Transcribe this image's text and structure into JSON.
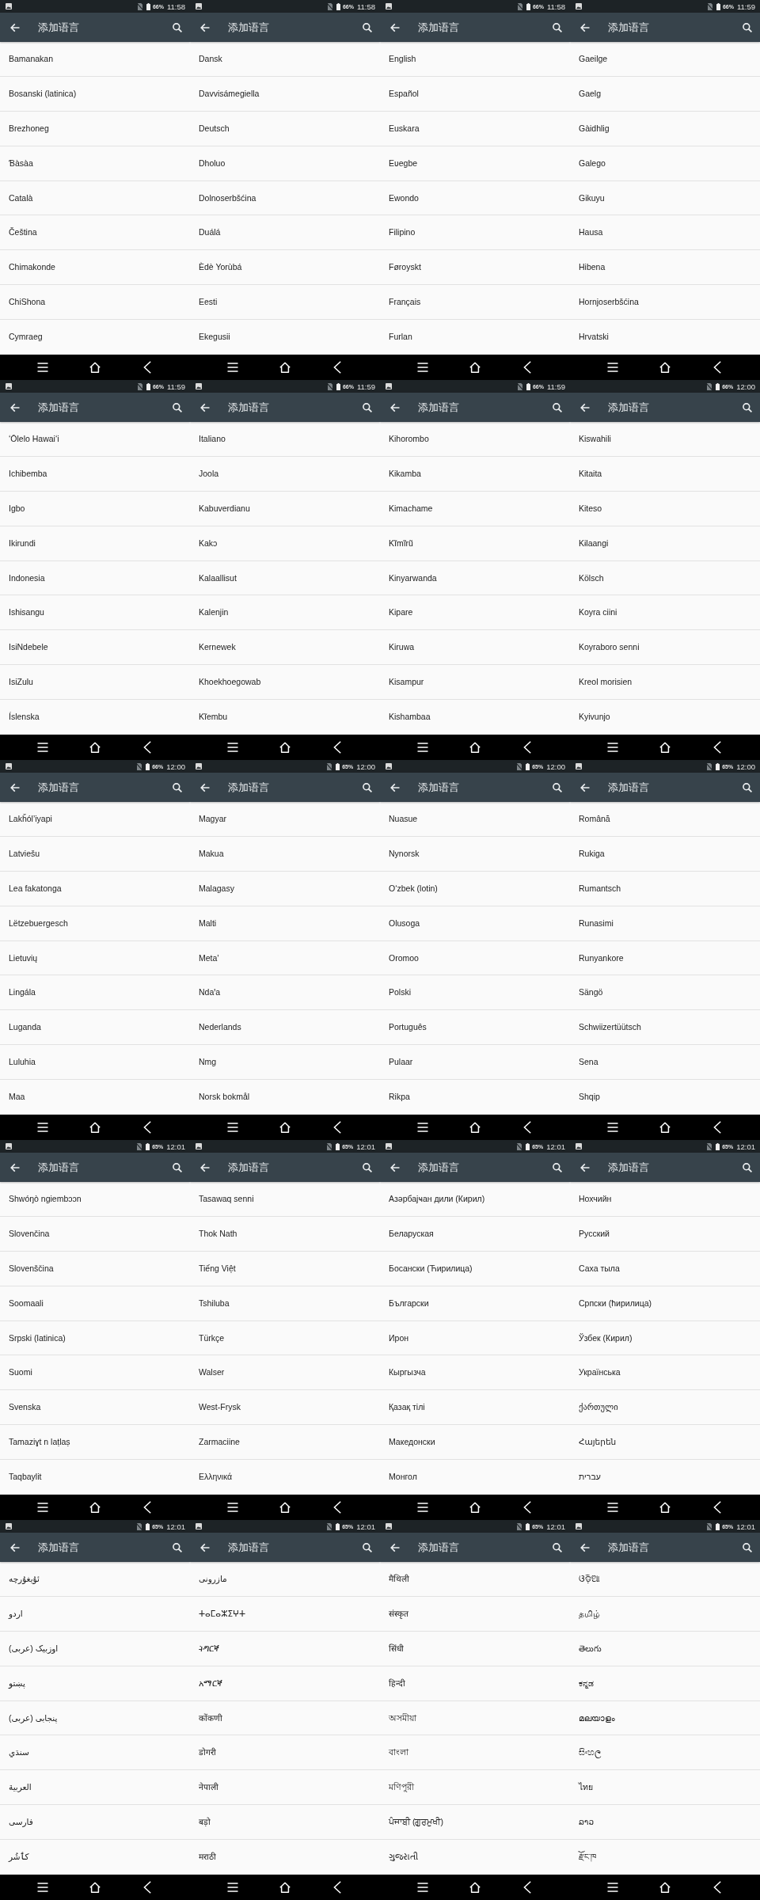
{
  "screens": [
    {
      "status_bar": {
        "picture_notification": true,
        "battery": "66%",
        "time": "11:58"
      },
      "app_bar": {
        "title": "添加语言"
      },
      "languages": [
        "Bamanakan",
        "Bosanski (latinica)",
        "Brezhoneg",
        "Ɓàsàa",
        "Català",
        "Čeština",
        "Chimakonde",
        "ChiShona",
        "Cymraeg"
      ]
    },
    {
      "status_bar": {
        "picture_notification": true,
        "battery": "66%",
        "time": "11:58"
      },
      "app_bar": {
        "title": "添加语言"
      },
      "languages": [
        "Dansk",
        "Davvisámegiella",
        "Deutsch",
        "Dholuo",
        "Dolnoserbšćina",
        "Duálá",
        "Èdè Yorùbá",
        "Eesti",
        "Ekegusii"
      ]
    },
    {
      "status_bar": {
        "picture_notification": true,
        "battery": "66%",
        "time": "11:58"
      },
      "app_bar": {
        "title": "添加语言"
      },
      "languages": [
        "English",
        "Español",
        "Euskara",
        "Eʋegbe",
        "Ewondo",
        "Filipino",
        "Føroyskt",
        "Français",
        "Furlan"
      ]
    },
    {
      "status_bar": {
        "picture_notification": true,
        "battery": "66%",
        "time": "11:59"
      },
      "app_bar": {
        "title": "添加语言"
      },
      "languages": [
        "Gaeilge",
        "Gaelg",
        "Gàidhlig",
        "Galego",
        "Gikuyu",
        "Hausa",
        "Hibena",
        "Hornjoserbšćina",
        "Hrvatski"
      ]
    },
    {
      "status_bar": {
        "picture_notification": true,
        "battery": "66%",
        "time": "11:59"
      },
      "app_bar": {
        "title": "添加语言"
      },
      "languages": [
        "ʻŌlelo Hawaiʻi",
        "Ichibemba",
        "Igbo",
        "Ikirundi",
        "Indonesia",
        "Ishisangu",
        "IsiNdebele",
        "IsiZulu",
        "Íslenska"
      ]
    },
    {
      "status_bar": {
        "picture_notification": true,
        "battery": "66%",
        "time": "11:59"
      },
      "app_bar": {
        "title": "添加语言"
      },
      "languages": [
        "Italiano",
        "Joola",
        "Kabuverdianu",
        "Kakɔ",
        "Kalaallisut",
        "Kalenjin",
        "Kernewek",
        "Khoekhoegowab",
        "Kĩembu"
      ]
    },
    {
      "status_bar": {
        "picture_notification": true,
        "battery": "66%",
        "time": "11:59"
      },
      "app_bar": {
        "title": "添加语言"
      },
      "languages": [
        "Kihorombo",
        "Kikamba",
        "Kimachame",
        "Kĩmĩrũ",
        "Kinyarwanda",
        "Kipare",
        "Kiruwa",
        "Kisampur",
        "Kishambaa"
      ]
    },
    {
      "status_bar": {
        "picture_notification": false,
        "battery": "66%",
        "time": "12:00"
      },
      "app_bar": {
        "title": "添加语言"
      },
      "languages": [
        "Kiswahili",
        "Kitaita",
        "Kiteso",
        "Kɨlaangi",
        "Kölsch",
        "Koyra ciini",
        "Koyraboro senni",
        "Kreol morisien",
        "Kyivunjo"
      ]
    },
    {
      "status_bar": {
        "picture_notification": true,
        "battery": "66%",
        "time": "12:00"
      },
      "app_bar": {
        "title": "添加语言"
      },
      "languages": [
        "Lakȟólʼiyapi",
        "Latviešu",
        "Lea fakatonga",
        "Lëtzebuergesch",
        "Lietuvių",
        "Lingála",
        "Luganda",
        "Luluhia",
        "Maa"
      ]
    },
    {
      "status_bar": {
        "picture_notification": true,
        "battery": "65%",
        "time": "12:00"
      },
      "app_bar": {
        "title": "添加语言"
      },
      "languages": [
        "Magyar",
        "Makua",
        "Malagasy",
        "Malti",
        "Metaʼ",
        "Ndaꞌa",
        "Nederlands",
        "Nmg",
        "Norsk bokmål"
      ]
    },
    {
      "status_bar": {
        "picture_notification": true,
        "battery": "65%",
        "time": "12:00"
      },
      "app_bar": {
        "title": "添加语言"
      },
      "languages": [
        "Nuasue",
        "Nynorsk",
        "O‘zbek (lotin)",
        "Olusoga",
        "Oromoo",
        "Polski",
        "Português",
        "Pulaar",
        "Rikpa"
      ]
    },
    {
      "status_bar": {
        "picture_notification": true,
        "battery": "65%",
        "time": "12:00"
      },
      "app_bar": {
        "title": "添加语言"
      },
      "languages": [
        "Română",
        "Rukiga",
        "Rumantsch",
        "Runasimi",
        "Runyankore",
        "Sängö",
        "Schwiizertüütsch",
        "Sena",
        "Shqip"
      ]
    },
    {
      "status_bar": {
        "picture_notification": true,
        "battery": "65%",
        "time": "12:01"
      },
      "app_bar": {
        "title": "添加语言"
      },
      "languages": [
        "Shwóŋò ngiembɔɔn",
        "Slovenčina",
        "Slovenščina",
        "Soomaali",
        "Srpski (latinica)",
        "Suomi",
        "Svenska",
        "Tamaziɣt n laṭlaṣ",
        "Taqbaylit"
      ]
    },
    {
      "status_bar": {
        "picture_notification": true,
        "battery": "65%",
        "time": "12:01"
      },
      "app_bar": {
        "title": "添加语言"
      },
      "languages": [
        "Tasawaq senni",
        "Thok Nath",
        "Tiếng Việt",
        "Tshiluba",
        "Türkçe",
        "Walser",
        "West-Frysk",
        "Zarmaciine",
        "Ελληνικά"
      ]
    },
    {
      "status_bar": {
        "picture_notification": true,
        "battery": "65%",
        "time": "12:01"
      },
      "app_bar": {
        "title": "添加语言"
      },
      "languages": [
        "Азәрбајҹан дили (Кирил)",
        "Беларуская",
        "Босански (Ћирилица)",
        "Български",
        "Ирон",
        "Кыргызча",
        "Қазақ тілі",
        "Македонски",
        "Монгол"
      ]
    },
    {
      "status_bar": {
        "picture_notification": true,
        "battery": "65%",
        "time": "12:01"
      },
      "app_bar": {
        "title": "添加语言"
      },
      "languages": [
        "Нохчийн",
        "Русский",
        "Саха тыла",
        "Српски (ћирилица)",
        "Ўзбек (Кирил)",
        "Українська",
        "ქართული",
        "Հայերեն",
        "עברית"
      ]
    },
    {
      "status_bar": {
        "picture_notification": true,
        "battery": "65%",
        "time": "12:01"
      },
      "app_bar": {
        "title": "添加语言"
      },
      "languages": [
        "ئۇيغۇرچە",
        "اردو",
        "اوزبیک (عربی)",
        "پښتو",
        "پنجابی (عربی)",
        "سنڌي",
        "العربية",
        "فارسی",
        "کٲشُر"
      ]
    },
    {
      "status_bar": {
        "picture_notification": true,
        "battery": "65%",
        "time": "12:01"
      },
      "app_bar": {
        "title": "添加语言"
      },
      "languages": [
        "مازرونی",
        "ⵜⴰⵎⴰⵣⵉⵖⵜ",
        "ትግርኛ",
        "አማርኛ",
        "कोंकणी",
        "डोगरी",
        "नेपाली",
        "बड़ो",
        "मराठी"
      ]
    },
    {
      "status_bar": {
        "picture_notification": true,
        "battery": "65%",
        "time": "12:01"
      },
      "app_bar": {
        "title": "添加语言"
      },
      "languages": [
        "मैथिली",
        "संस्कृत",
        "सिंधी",
        "हिन्दी",
        "অসমীয়া",
        "বাংলা",
        "মণিপুরী",
        "ਪੰਜਾਬੀ (ਗੁਰਮੁਖੀ)",
        "ગુજરાતી"
      ]
    },
    {
      "status_bar": {
        "picture_notification": true,
        "battery": "65%",
        "time": "12:01"
      },
      "app_bar": {
        "title": "添加语言"
      },
      "languages": [
        "ଓଡ଼ିଆ",
        "தமிழ்",
        "తెలుగు",
        "ಕನ್ನಡ",
        "മലയാളം",
        "සිංහල",
        "ไทย",
        "ລາວ",
        "རྫོང་ཁ"
      ]
    }
  ]
}
